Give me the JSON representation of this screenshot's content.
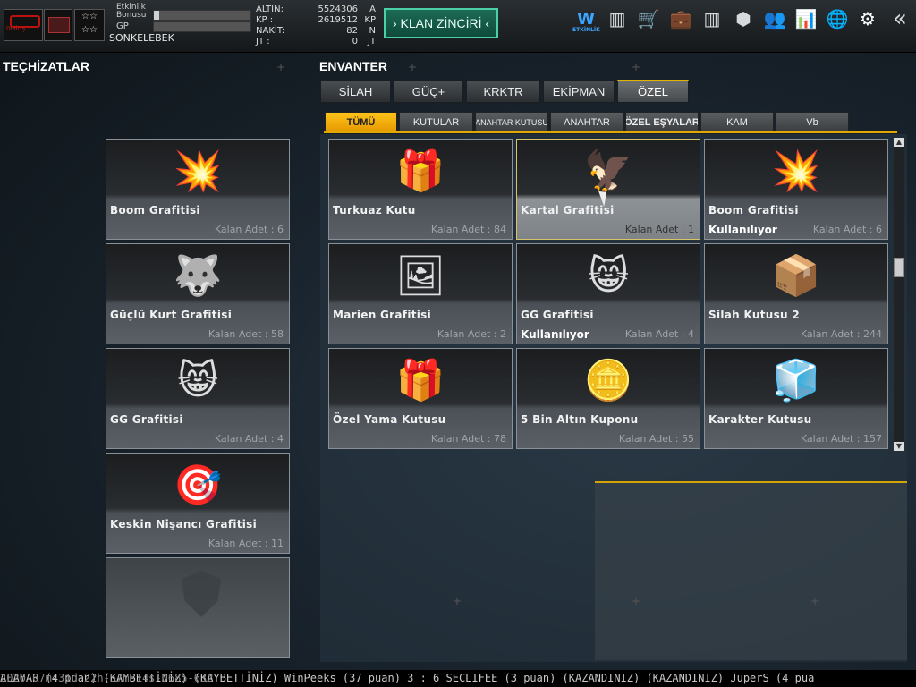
{
  "topbar": {
    "clan_logo_text": "DİRİLİŞ",
    "bonus_label": "Etkinlik Bonusu",
    "bonus_progress": 0.06,
    "gp_label": "GP",
    "gp_progress": 0.0,
    "player_name": "SONKELEBEK",
    "stats": [
      {
        "label": "ALTIN:",
        "value": "5524306",
        "unit": "A"
      },
      {
        "label": "KP :",
        "value": "2619512",
        "unit": "KP"
      },
      {
        "label": "NAKİT:",
        "value": "82",
        "unit": "N"
      },
      {
        "label": "JT :",
        "value": "0",
        "unit": "JT"
      }
    ],
    "clan_button": "› KLAN ZİNCİRİ ‹",
    "event_icon_label": "ETKİNLİK",
    "icons": [
      "event-icon",
      "ranking-icon",
      "shop-icon",
      "briefcase-icon",
      "stripes-icon",
      "box-icon",
      "friends-icon",
      "stats-icon",
      "globe-icon",
      "gear-icon",
      "back-icon"
    ]
  },
  "left": {
    "title": "TEÇHİZATLAR",
    "items": [
      {
        "name": "Boom Grafitisi",
        "qty": "Kalan Adet : 6",
        "art": "💥"
      },
      {
        "name": "Güçlü Kurt Grafitisi",
        "qty": "Kalan Adet : 58",
        "art": "🐺"
      },
      {
        "name": "GG Grafitisi",
        "qty": "Kalan Adet : 4",
        "art": "😸"
      },
      {
        "name": "Keskin Nişancı Grafitisi",
        "qty": "Kalan Adet : 11",
        "art": "🎯"
      }
    ]
  },
  "inventory": {
    "title": "ENVANTER",
    "tabs": [
      "SİLAH",
      "GÜÇ+",
      "KRKTR",
      "EKİPMAN",
      "ÖZEL"
    ],
    "active_tab": "ÖZEL",
    "subtabs": [
      "TÜMÜ",
      "KUTULAR",
      "ANAHTAR KUTUSU",
      "ANAHTAR",
      "ÖZEL EŞYALAR",
      "KAM",
      "Vb"
    ],
    "active_subtab": "TÜMÜ",
    "items": [
      {
        "name": "Turkuaz Kutu",
        "qty": "Kalan Adet : 84",
        "art": "🎁",
        "using": ""
      },
      {
        "name": "Kartal Grafitisi",
        "qty": "Kalan Adet : 1",
        "art": "🦅",
        "using": ""
      },
      {
        "name": "Boom Grafitisi",
        "qty": "Kalan Adet : 6",
        "art": "💥",
        "using": "Kullanılıyor"
      },
      {
        "name": "Marien Grafitisi",
        "qty": "Kalan Adet : 2",
        "art": "🖼",
        "using": ""
      },
      {
        "name": "GG Grafitisi",
        "qty": "Kalan Adet : 4",
        "art": "😸",
        "using": "Kullanılıyor"
      },
      {
        "name": "Silah Kutusu 2",
        "qty": "Kalan Adet : 244",
        "art": "📦",
        "using": ""
      },
      {
        "name": "Özel Yama Kutusu",
        "qty": "Kalan Adet : 78",
        "art": "🎁",
        "using": ""
      },
      {
        "name": "5 Bin Altın Kuponu",
        "qty": "Kalan Adet : 55",
        "art": "🪙",
        "using": ""
      },
      {
        "name": "Karakter Kutusu",
        "qty": "Kalan Adet : 157",
        "art": "🧊",
        "using": ""
      }
    ]
  },
  "ticker": "ALAYAR (4 puan) (KAYBETTİNİZ)   (KAYBETTİNİZ) WinPeeks (37 puan) 3 : 6 SECLIFEE (3 puan) (KAZANDINIZ)   (KAZANDINIZ) JuperS (4 pua",
  "timestamp": "2020-07m-31d-22h-57m-14s-0685-632"
}
